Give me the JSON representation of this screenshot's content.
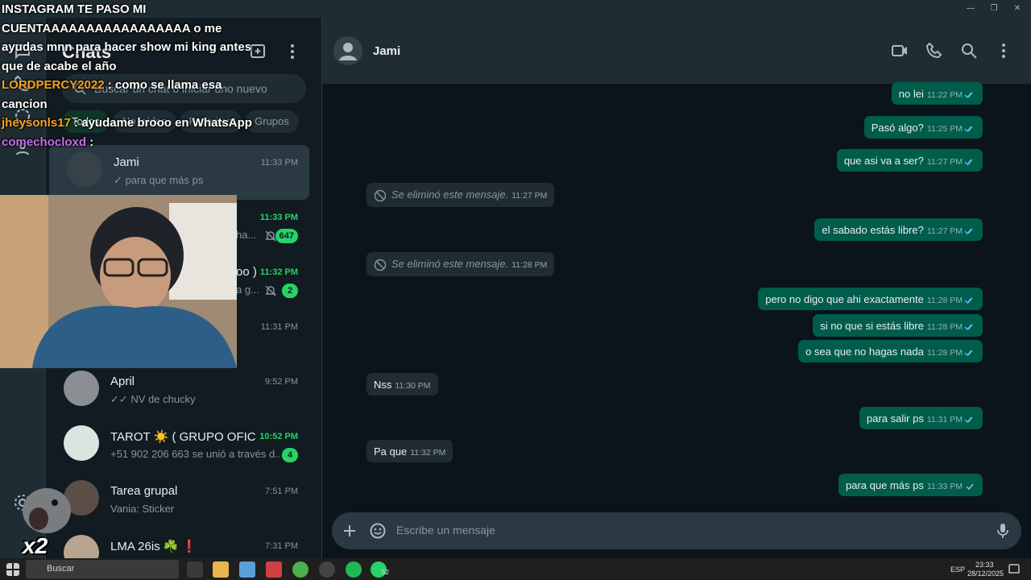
{
  "window": {
    "controls": [
      "—",
      "❐",
      "✕"
    ]
  },
  "chatlist": {
    "title": "Chats",
    "search_placeholder": "Buscar un chat o iniciar uno nuevo",
    "filters": [
      "Todos",
      "No leídos",
      "Favoritos",
      "Grupos"
    ],
    "chats": [
      {
        "name": "Jami",
        "time": "11:33 PM",
        "preview": "✓ para que más ps",
        "unread": false,
        "selected": true
      },
      {
        "name": "",
        "time": "11:33 PM",
        "preview": "ha...",
        "unread": true,
        "muted": true,
        "badge": "647"
      },
      {
        "name": "oo )",
        "time": "11:32 PM",
        "preview": "a g...",
        "unread": true,
        "muted": true,
        "badge": "2"
      },
      {
        "name": "",
        "time": "11:31 PM",
        "preview": "",
        "unread": false
      },
      {
        "name": "April",
        "time": "9:52 PM",
        "preview": "✓✓ NV de chucky",
        "unread": false
      },
      {
        "name": "TAROT ☀️ ( GRUPO OFICI...",
        "time": "10:52 PM",
        "preview": "+51 902 206 663 se unió a través d...",
        "unread": true,
        "badge": "4"
      },
      {
        "name": "Tarea grupal",
        "time": "7:51 PM",
        "preview": "Vania: Sticker",
        "unread": false
      },
      {
        "name": "LMA 26is ☘️ ❗",
        "time": "7:31 PM",
        "preview": "",
        "unread": false
      }
    ]
  },
  "overlay": {
    "lines": [
      {
        "user": "",
        "text": "INSTAGRAM TE PASO MI CUENTAAAAAAAAAAAAAAAAA o me ayudas mnn para hacer show mi king antes que de acabe el año"
      },
      {
        "user": "LORDPERCY2022",
        "text": " : como se llama esa cancion"
      },
      {
        "user": "jheysonls17",
        "text": " : ayudame brooo en WhatsApp"
      },
      {
        "user": "comechocloxd",
        "text": " :"
      }
    ],
    "emote_multiplier": "x2"
  },
  "conversation": {
    "contact": "Jami",
    "composer_placeholder": "Escribe un mensaje",
    "messages": [
      {
        "dir": "out",
        "text": "no lei",
        "time": "11:22 PM"
      },
      {
        "dir": "out",
        "text": "Pasó algo?",
        "time": "11:25 PM"
      },
      {
        "dir": "out",
        "text": "que asi va a ser?",
        "time": "11:27 PM"
      },
      {
        "dir": "in",
        "text": "Se eliminó este mensaje.",
        "time": "11:27 PM",
        "deleted": true
      },
      {
        "dir": "out",
        "text": "el sabado estás libre?",
        "time": "11:27 PM"
      },
      {
        "dir": "in",
        "text": "Se eliminó este mensaje.",
        "time": "11:28 PM",
        "deleted": true
      },
      {
        "dir": "out",
        "text": "pero no digo que ahi exactamente",
        "time": "11:28 PM"
      },
      {
        "dir": "out",
        "text": "si no que si estás libre",
        "time": "11:28 PM"
      },
      {
        "dir": "out",
        "text": "o sea que no hagas nada",
        "time": "11:28 PM"
      },
      {
        "dir": "in",
        "text": "Nss",
        "time": "11:30 PM"
      },
      {
        "dir": "out",
        "text": "para salir ps",
        "time": "11:31 PM"
      },
      {
        "dir": "in",
        "text": "Pa que",
        "time": "11:32 PM"
      },
      {
        "dir": "out",
        "text": "para que más ps",
        "time": "11:33 PM"
      }
    ]
  },
  "taskbar": {
    "search": "Buscar",
    "lang": "ESP",
    "time": "23:33",
    "date": "28/12/2025",
    "whatsapp_badge": "52"
  },
  "colors": {
    "accent": "#25d366",
    "outgoing": "#005c4b",
    "incoming": "#202c33",
    "background": "#0b141a"
  }
}
